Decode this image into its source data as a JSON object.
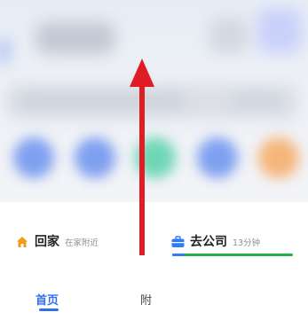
{
  "destinations": {
    "home": {
      "title": "回家",
      "subtitle": "在家附近",
      "icon": "home-icon",
      "color": "#f39a17"
    },
    "work": {
      "title": "去公司",
      "subtitle": "13分钟",
      "icon": "briefcase-icon",
      "color": "#2f7cf6",
      "route_color": "#22b04b"
    }
  },
  "tabs": [
    {
      "label": "首页",
      "active": true
    },
    {
      "label": "附",
      "active": false
    }
  ],
  "overlay": {
    "arrow_color": "#e01c25",
    "direction": "up"
  },
  "colors": {
    "accent": "#2f6ff0"
  }
}
